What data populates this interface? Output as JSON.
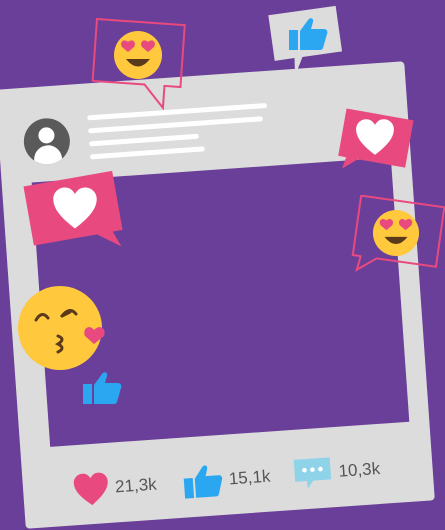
{
  "post": {
    "stats": {
      "likes": "21,3k",
      "thumbs": "15,1k",
      "comments": "10,3k"
    }
  },
  "colors": {
    "background": "#6a3f99",
    "frame": "#dcdcdc",
    "heart": "#e84a7f",
    "thumb": "#2aa7f0",
    "comment": "#8fd3e8",
    "emoji": "#ffc83d"
  },
  "icons": [
    "heart-eyes-emoji-icon",
    "thumbs-up-icon",
    "heart-icon",
    "kiss-emoji-icon",
    "comment-icon",
    "avatar-icon"
  ]
}
